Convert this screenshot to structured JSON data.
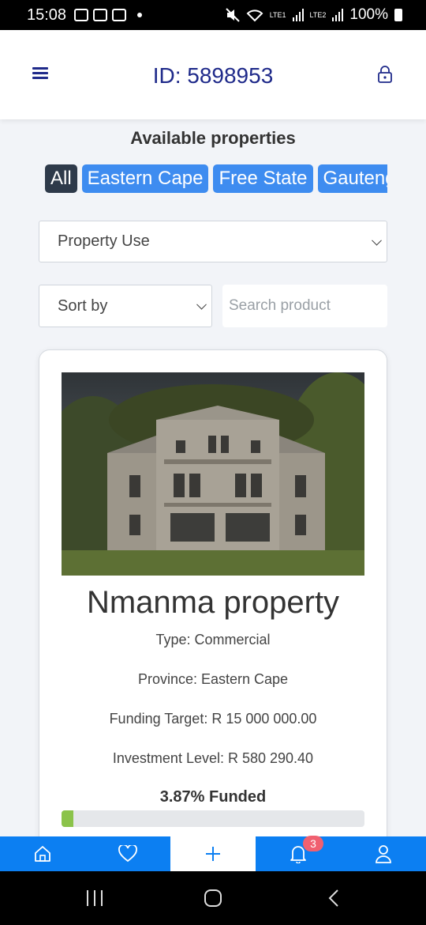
{
  "status_bar": {
    "time": "15:08",
    "network_1": "LTE1",
    "network_2": "LTE2",
    "battery": "100%"
  },
  "header": {
    "id_label": "ID: 5898953",
    "menu_icon": "hamburger-menu-icon",
    "lock_icon": "lock-icon"
  },
  "page_title": "Available properties",
  "province_filters": [
    {
      "label": "All",
      "active": true
    },
    {
      "label": "Eastern Cape",
      "active": false
    },
    {
      "label": "Free State",
      "active": false
    },
    {
      "label": "Gauteng",
      "active": false
    }
  ],
  "filters": {
    "property_use": "Property Use",
    "sort_by": "Sort by",
    "search_placeholder": "Search product"
  },
  "property_card": {
    "name": "Nmanma property",
    "type": "Type: Commercial",
    "province": "Province: Eastern Cape",
    "funding_target": "Funding Target: R 15 000 000.00",
    "investment_level": "Investment Level: R 580 290.40",
    "funded_label": "3.87% Funded",
    "funded_fraction": 0.0387
  },
  "bottom_nav": {
    "items": [
      "home-icon",
      "heart-icon",
      "plus-icon",
      "bell-icon",
      "user-icon"
    ],
    "notification_count": "3"
  },
  "colors": {
    "brand_blue": "#0c7ff2",
    "chip_blue": "#3e8cf0",
    "active_chip": "#2e3a4a",
    "header_text": "#1f2a8a",
    "progress_green": "#8bc34a",
    "badge_red": "#f06070"
  }
}
